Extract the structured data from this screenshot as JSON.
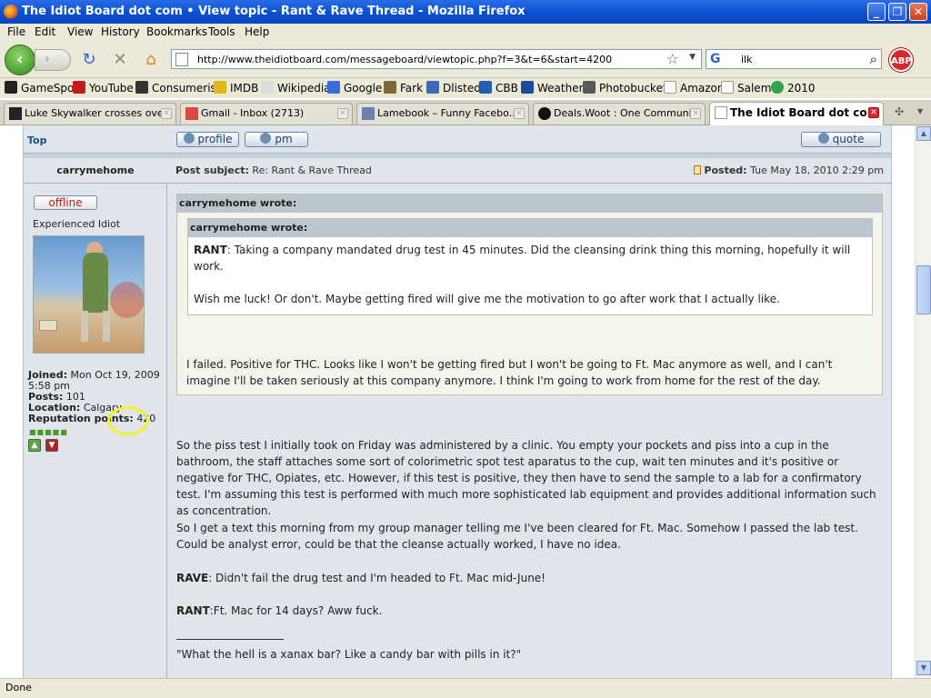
{
  "window": {
    "title": "The Idiot Board dot com • View topic - Rant & Rave Thread - Mozilla Firefox",
    "controls": {
      "minimize": "_",
      "maximize": "❐",
      "close": "✕"
    }
  },
  "menu": [
    "File",
    "Edit",
    "View",
    "History",
    "Bookmarks",
    "Tools",
    "Help"
  ],
  "nav": {
    "url": "http://www.theidiotboard.com/messageboard/viewtopic.php?f=3&t=6&start=4200",
    "search_value": "ilk",
    "abp_label": "ABP"
  },
  "bookmarks": [
    "GameSpot",
    "YouTube",
    "Consumerist",
    "IMDB",
    "Wikipedia",
    "Google",
    "Fark",
    "Dlisted",
    "CBB",
    "Weather",
    "Photobucket",
    "Amazon",
    "Salem",
    "2010"
  ],
  "tabs": [
    {
      "label": "Luke Skywalker crosses ove..."
    },
    {
      "label": "Gmail - Inbox (2713)"
    },
    {
      "label": "Lamebook – Funny Facebo..."
    },
    {
      "label": "Deals.Woot : One Communi..."
    },
    {
      "label": "The Idiot Board dot co...",
      "active": true
    }
  ],
  "post": {
    "top_link": "Top",
    "buttons": {
      "profile": "profile",
      "pm": "pm",
      "quote": "quote"
    },
    "author": "carrymehome",
    "subject_label": "Post subject:",
    "subject": "Re: Rant & Rave Thread",
    "posted_label": "Posted:",
    "posted": "Tue May 18, 2010 2:29 pm",
    "status": "offline",
    "rank": "Experienced Idiot",
    "profile": {
      "joined_label": "Joined:",
      "joined": "Mon Oct 19, 2009 5:58 pm",
      "posts_label": "Posts:",
      "posts": "101",
      "location_label": "Location:",
      "location": "Calgary",
      "reputation_label": "Reputation points:",
      "reputation": "420"
    },
    "outer_quote": {
      "header": "carrymehome wrote:",
      "inner_quote": {
        "header": "carrymehome wrote:",
        "rant_label": "RANT",
        "line1": ": Taking a company mandated drug test in 45 minutes. Did the cleansing drink thing this morning, hopefully it will work.",
        "line2": "Wish me luck! Or don't. Maybe getting fired will give me the motivation to go after work that I actually like."
      },
      "reply": "I failed. Positive for THC. Looks like I won't be getting fired but I won't be going to Ft. Mac anymore as well, and I can't imagine I'll be taken seriously at this company anymore. I think I'm going to work from home for the rest of the day."
    },
    "body": {
      "p1": "So the piss test I initially took on Friday was administered by a clinic. You empty your pockets and piss into a cup in the bathroom, the staff attaches some sort of colorimetric spot test aparatus to the cup, wait ten minutes and it's positive or negative for THC, Opiates, etc. However, if this test is positive, they then have to send the sample to a lab for a confirmatory test. I'm assuming this test is performed with much more sophisticated lab equipment and provides additional information such as concentration.",
      "p2": "So I get a text this morning from my group manager telling me I've been cleared for Ft. Mac. Somehow I passed the lab test. Could be analyst error, could be that the cleanse actually worked, I have no idea.",
      "rave_label": "RAVE",
      "rave_text": ": Didn't fail the drug test and I'm headed to Ft. Mac mid-June!",
      "rant_label": "RANT",
      "rant_text": ":Ft. Mac for 14 days? Aww fuck."
    },
    "signature": "\"What the hell is a xanax bar? Like a candy bar with pills in it?\""
  },
  "status_text": "Done"
}
